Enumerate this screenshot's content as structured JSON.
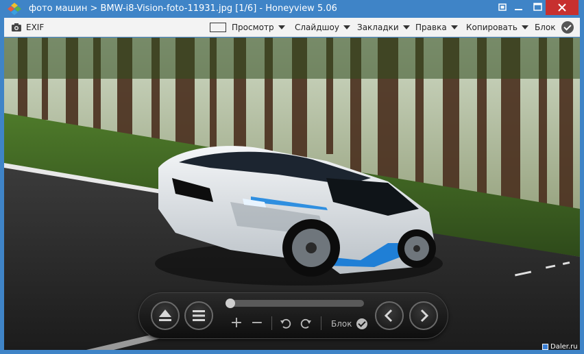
{
  "window": {
    "title": "фото машин > BMW-i8-Vision-foto-11931.jpg [1/6] - Honeyview 5.06"
  },
  "toolbar": {
    "exif_label": "EXIF",
    "view_label": "Просмотр",
    "slideshow_label": "Слайдшоу",
    "bookmarks_label": "Закладки",
    "edit_label": "Правка",
    "copy_label": "Копировать",
    "block_label": "Блок"
  },
  "controls": {
    "block_label": "Блок",
    "slider_position": 0.0
  },
  "watermark": "Daler.ru",
  "colors": {
    "titlebar": "#3f84c7",
    "close": "#c7302f",
    "toolbar_bg": "#f3f3f3"
  }
}
